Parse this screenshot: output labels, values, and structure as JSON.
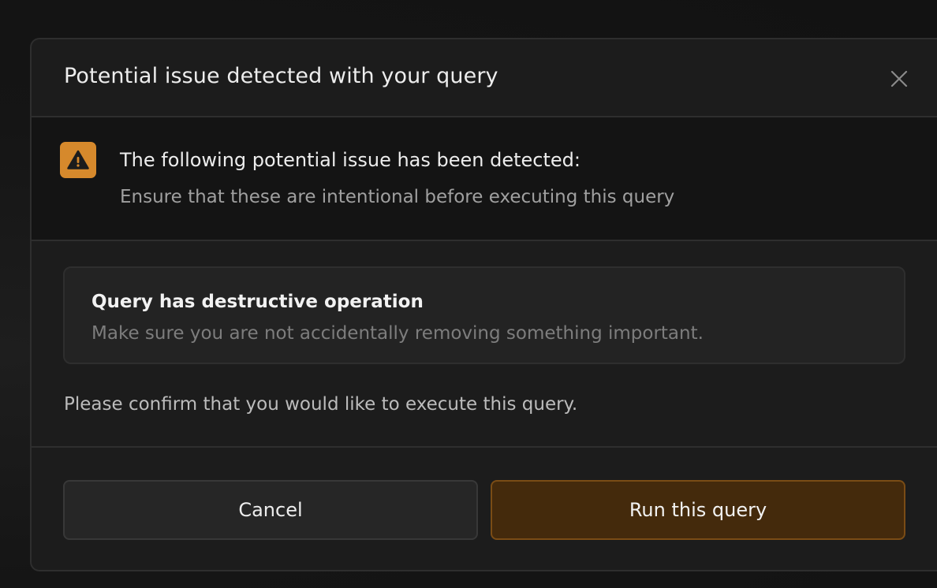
{
  "dialog": {
    "title": "Potential issue detected with your query",
    "close_icon": "close-icon"
  },
  "alert": {
    "icon": "warning-icon",
    "icon_color": "#d6892c",
    "title": "The following potential issue has been detected:",
    "subtitle": "Ensure that these are intentional before executing this query"
  },
  "issue": {
    "title": "Query has destructive operation",
    "description": "Make sure you are not accidentally removing something important."
  },
  "confirm_text": "Please confirm that you would like to execute this query.",
  "buttons": {
    "cancel_label": "Cancel",
    "run_label": "Run this query",
    "run_color": "#442a0c"
  }
}
